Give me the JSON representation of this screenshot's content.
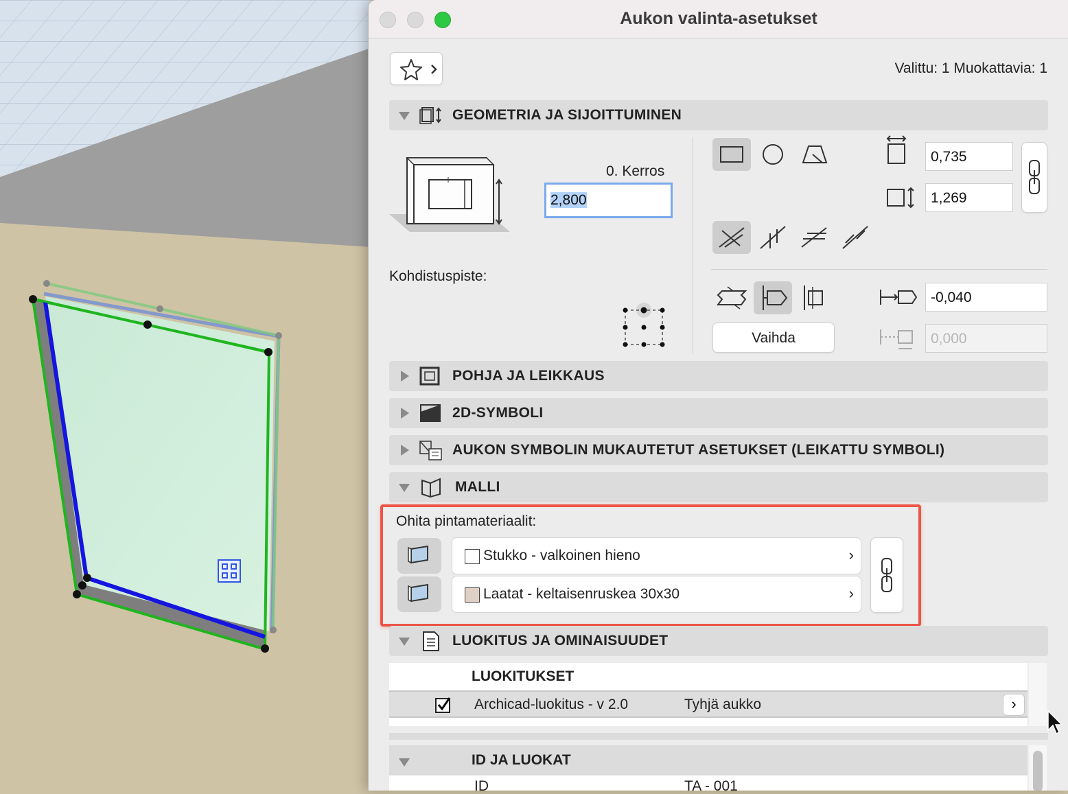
{
  "dialog": {
    "title": "Aukon valinta-asetukset",
    "selection_info": "Valittu: 1 Muokattavia: 1"
  },
  "geometry": {
    "header": "GEOMETRIA JA SIJOITTUMINEN",
    "story_label": "0. Kerros",
    "elevation_value": "2,800",
    "anchor_label": "Kohdistuspiste:",
    "width_value": "0,735",
    "height_value": "1,269",
    "offset_value": "-0,040",
    "offset2_value": "0,000",
    "flip_button": "Vaihda"
  },
  "sections": {
    "floorplan": "POHJA JA LEIKKAUS",
    "symbol2d": "2D-SYMBOLI",
    "custom": "AUKON SYMBOLIN MUKAUTETUT ASETUKSET (LEIKATTU SYMBOLI)",
    "model": "MALLI",
    "classification": "LUOKITUS JA OMINAISUUDET"
  },
  "model": {
    "override_label": "Ohita pintamateriaalit:",
    "surfaces": [
      {
        "name": "Stukko - valkoinen hieno",
        "swatch": "#ffffff"
      },
      {
        "name": "Laatat - keltaisenruskea 30x30",
        "swatch": "#e0d1c4"
      }
    ]
  },
  "classification": {
    "table_header": "LUOKITUKSET",
    "row_system": "Archicad-luokitus - v 2.0",
    "row_value": "Tyhjä aukko",
    "id_header": "ID JA LUOKAT",
    "id_label": "ID",
    "id_value": "TA - 001"
  },
  "colors": {
    "highlight_red": "#ec5548",
    "selection_green": "#1fb51f",
    "selection_blue": "#1515e0",
    "wall": "#cfc3a5",
    "grid": "#d7e1ec"
  }
}
